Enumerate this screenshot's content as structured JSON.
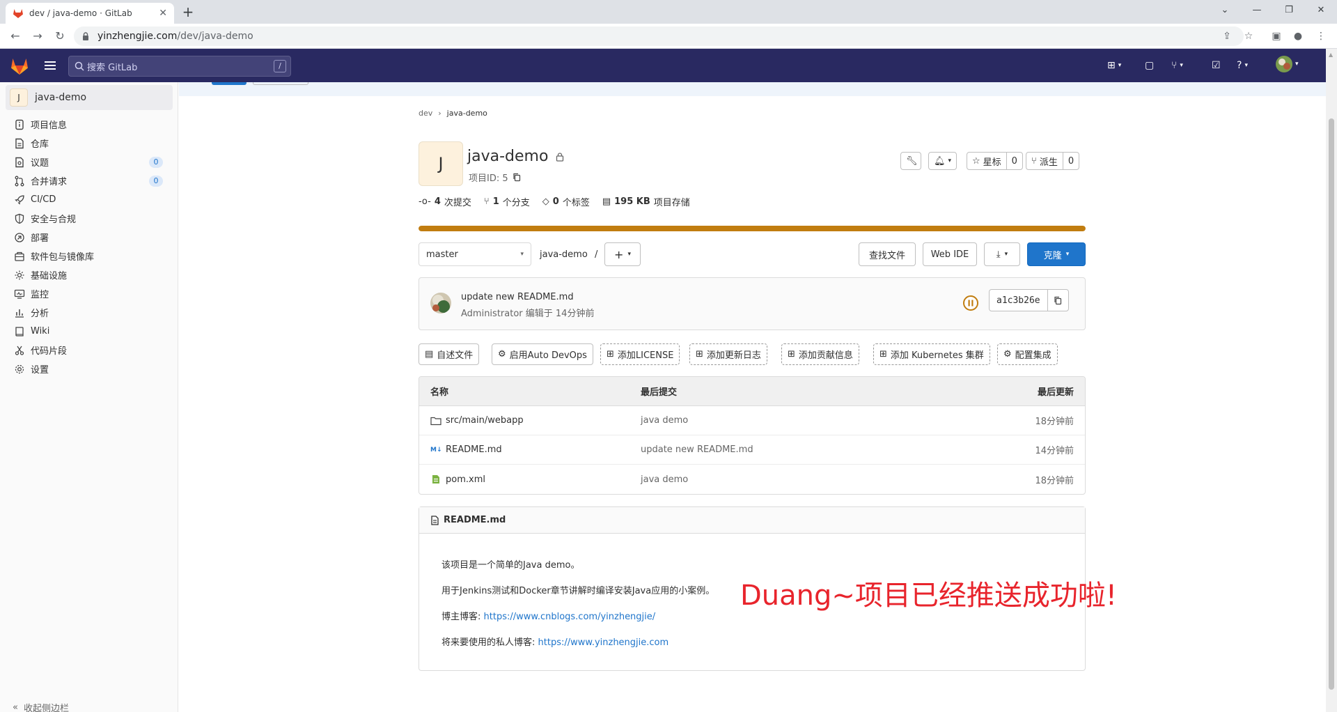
{
  "browser": {
    "tab_title": "dev / java-demo · GitLab",
    "url_host": "yinzhengjie.com",
    "url_path": "/dev/java-demo"
  },
  "header": {
    "search_placeholder": "搜索 GitLab",
    "search_shortcut": "/"
  },
  "sidebar": {
    "project_initial": "J",
    "project_name": "java-demo",
    "items": [
      {
        "label": "项目信息"
      },
      {
        "label": "仓库"
      },
      {
        "label": "议题",
        "badge": "0"
      },
      {
        "label": "合并请求",
        "badge": "0"
      },
      {
        "label": "CI/CD"
      },
      {
        "label": "安全与合规"
      },
      {
        "label": "部署"
      },
      {
        "label": "软件包与镜像库"
      },
      {
        "label": "基础设施"
      },
      {
        "label": "监控"
      },
      {
        "label": "分析"
      },
      {
        "label": "Wiki"
      },
      {
        "label": "代码片段"
      },
      {
        "label": "设置"
      }
    ],
    "collapse_label": "收起侧边栏"
  },
  "breadcrumb": {
    "group": "dev",
    "project": "java-demo"
  },
  "project": {
    "initial": "J",
    "name": "java-demo",
    "id_label": "项目ID: 5",
    "star_label": "星标",
    "star_count": "0",
    "fork_label": "派生",
    "fork_count": "0",
    "stats": {
      "commits_num": "4",
      "commits_label": "次提交",
      "branches_num": "1",
      "branches_label": "个分支",
      "tags_num": "0",
      "tags_label": "个标签",
      "storage_num": "195 KB",
      "storage_label": "项目存储"
    }
  },
  "repo": {
    "branch": "master",
    "path": "java-demo",
    "path_sep": "/",
    "find_file": "查找文件",
    "web_ide": "Web IDE",
    "clone": "克隆"
  },
  "commit": {
    "title": "update new README.md",
    "author": "Administrator",
    "meta_suffix": "编辑于 14分钟前",
    "sha": "a1c3b26e"
  },
  "quick_actions": [
    {
      "label": "自述文件"
    },
    {
      "label": "启用Auto DevOps"
    },
    {
      "label": "添加LICENSE"
    },
    {
      "label": "添加更新日志"
    },
    {
      "label": "添加贡献信息"
    },
    {
      "label": "添加 Kubernetes 集群"
    },
    {
      "label": "配置集成"
    }
  ],
  "files": {
    "headers": {
      "name": "名称",
      "last_commit": "最后提交",
      "last_update": "最后更新"
    },
    "rows": [
      {
        "name": "src/main/webapp",
        "commit": "java demo",
        "updated": "18分钟前",
        "icon": "folder-icon"
      },
      {
        "name": "README.md",
        "commit": "update new README.md",
        "updated": "14分钟前",
        "icon": "markdown-icon"
      },
      {
        "name": "pom.xml",
        "commit": "java demo",
        "updated": "18分钟前",
        "icon": "xml-file-icon"
      }
    ]
  },
  "readme": {
    "title": "README.md",
    "line1": "该项目是一个简单的Java demo。",
    "line2": "用于Jenkins测试和Docker章节讲解时编译安装Java应用的小案例。",
    "line3_prefix": "博主博客: ",
    "line3_link": "https://www.cnblogs.com/yinzhengjie/",
    "line4_prefix": "将来要使用的私人博客: ",
    "line4_link": "https://www.yinzhengjie.com"
  },
  "annotation": "Duang~项目已经推送成功啦!",
  "colors": {
    "header_bg": "#292961",
    "primary": "#1f75cb",
    "progress": "#c17d10",
    "annotation": "#e8242c"
  }
}
